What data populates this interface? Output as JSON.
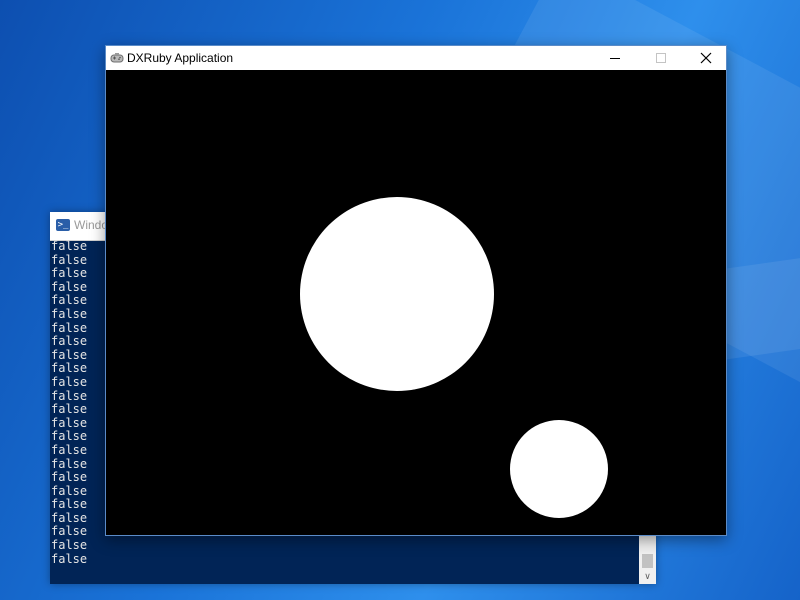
{
  "powershell_window": {
    "title": "Windo",
    "icon": "powershell-icon",
    "console_lines": [
      "false",
      "false",
      "false",
      "false",
      "false",
      "false",
      "false",
      "false",
      "false",
      "false",
      "false",
      "false",
      "false",
      "false",
      "false",
      "false",
      "false",
      "false",
      "false",
      "false",
      "false",
      "false",
      "false",
      "false"
    ],
    "background_color": "#012456",
    "text_color": "#e6e6e6",
    "scrollbar": {
      "down_arrow": "chevron-down-icon"
    }
  },
  "dxruby_window": {
    "title": "DXRuby Application",
    "icon": "gamepad-icon",
    "caption_buttons": [
      "minimize-icon",
      "maximize-icon",
      "close-icon"
    ],
    "canvas": {
      "background_color": "#000000",
      "circle_color": "#ffffff"
    }
  }
}
